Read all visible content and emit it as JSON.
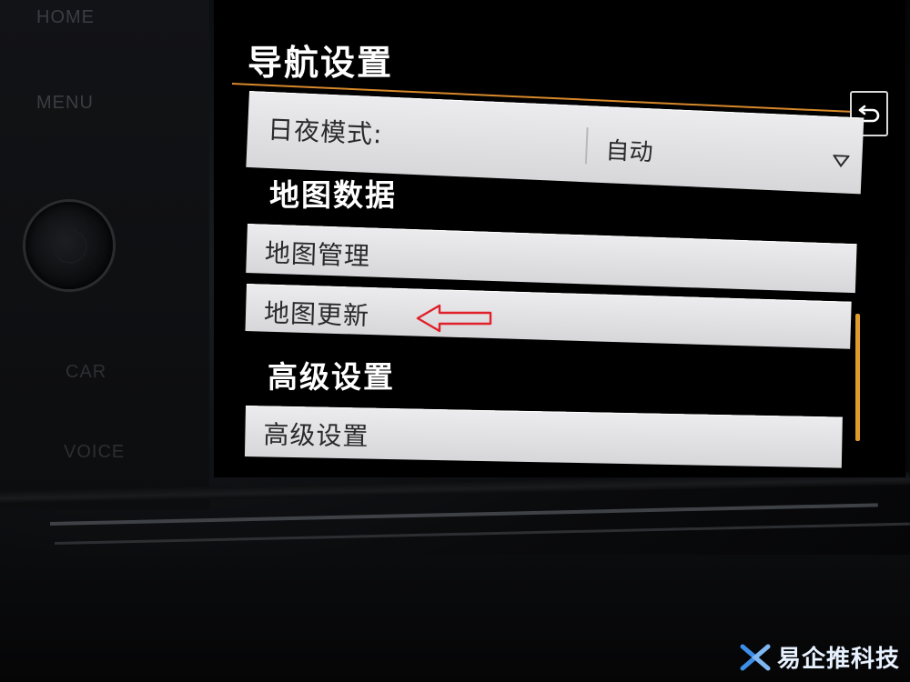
{
  "hardware_buttons": {
    "home": "HOME",
    "menu": "MENU",
    "car": "CAR",
    "voice": "VOICE"
  },
  "screen": {
    "title": "导航设置",
    "day_night_row": {
      "label": "日夜模式:",
      "value": "自动"
    },
    "sections": {
      "map_data": {
        "heading": "地图数据",
        "items": [
          "地图管理",
          "地图更新"
        ]
      },
      "advanced": {
        "heading": "高级设置",
        "items": [
          "高级设置"
        ]
      }
    }
  },
  "watermark": {
    "text": "易企推科技"
  },
  "colors": {
    "accent_orange": "#d8892a",
    "row_bg": "#e3e2e5",
    "annotation_red": "#e0202a"
  }
}
